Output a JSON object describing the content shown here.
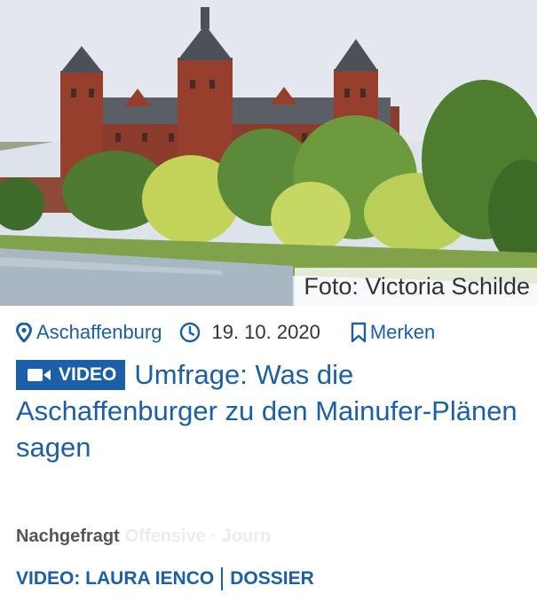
{
  "hero": {
    "image_alt": "Schloss Johannisburg am Mainufer",
    "credit": "Foto: Victoria Schilde"
  },
  "meta": {
    "location": "Aschaffenburg",
    "date": "19. 10. 2020",
    "bookmark_label": "Merken"
  },
  "article": {
    "badge_label": "VIDEO",
    "title": "Umfrage: Was die Aschaffenburger zu den Mainufer-Plänen sagen"
  },
  "series": {
    "label": "Nachgefragt",
    "faded_text": "Offensive · Journ"
  },
  "bylines": {
    "author": "VIDEO: LAURA IENCO",
    "section": "DOSSIER"
  },
  "colors": {
    "accent": "#1a5fa8",
    "river": "#a9b7c2",
    "sky": "#dfe4ea"
  }
}
